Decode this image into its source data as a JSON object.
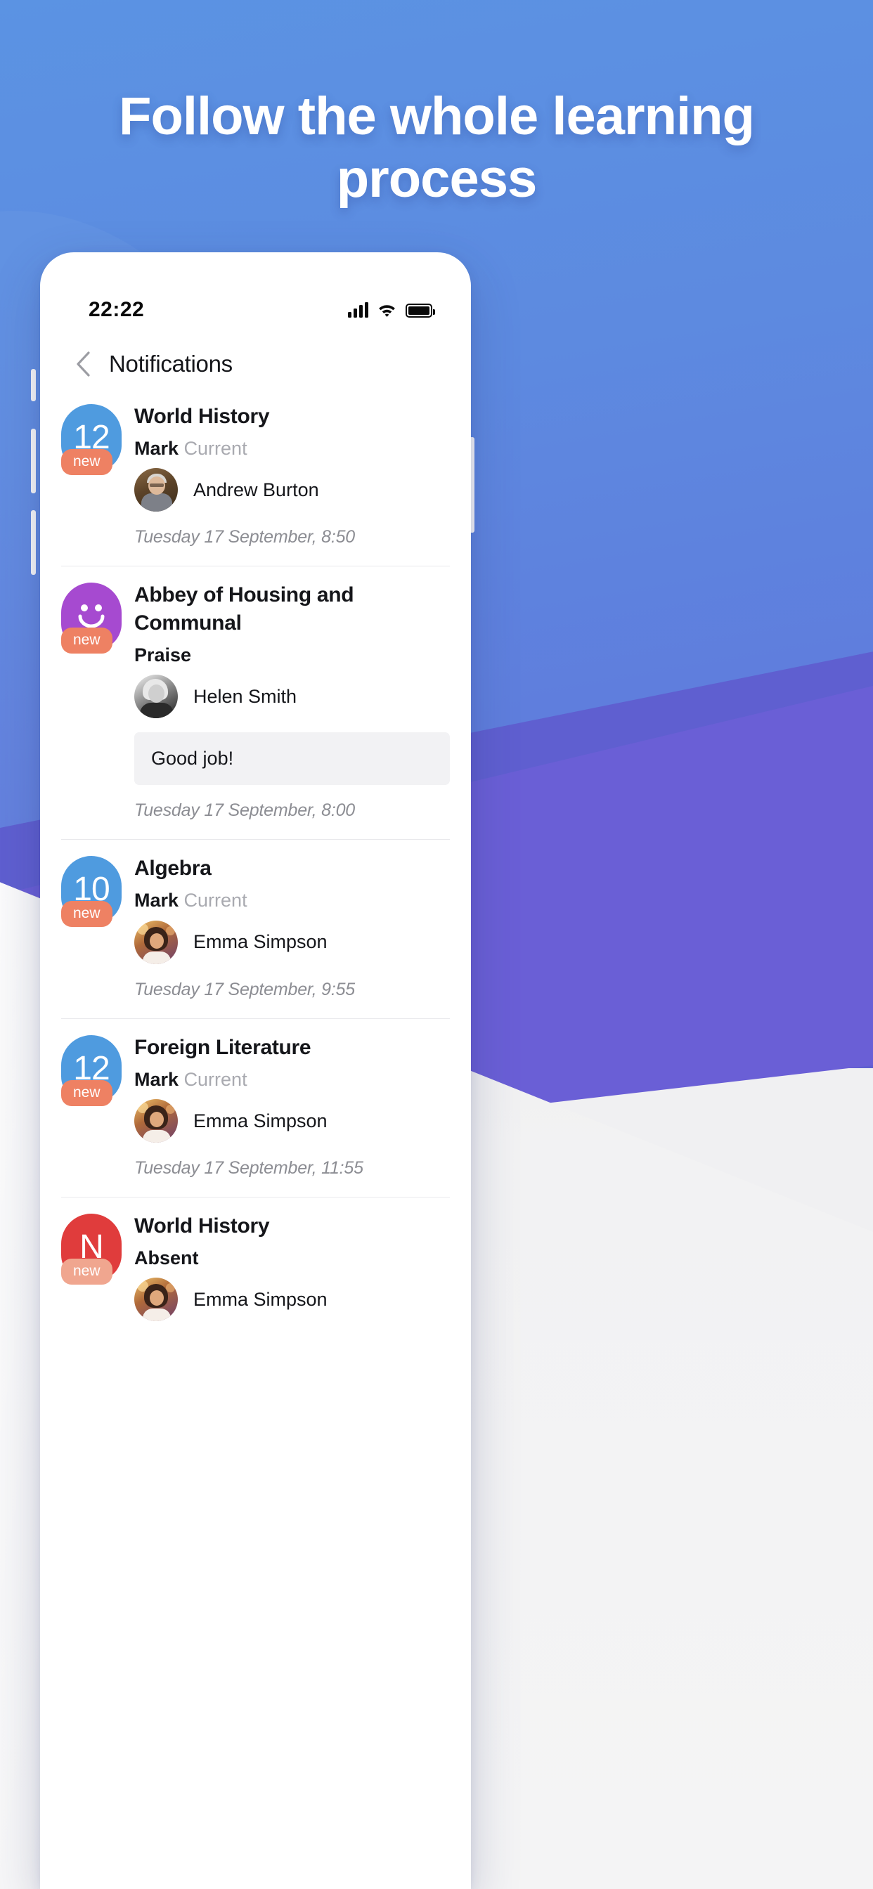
{
  "hero": {
    "headline": "Follow the whole learning process"
  },
  "colors": {
    "bg_blue_top": "#5b93e3",
    "bg_blue_bottom": "#6070da",
    "wave_purple": "#6a5fd6",
    "badge_blue": "#4f9bdf",
    "badge_purple": "#a64ad0",
    "badge_red": "#e03c3c",
    "pill_orange": "#ee8163",
    "pill_orange_light": "#f0a68f",
    "muted_text": "#a9aab0",
    "time_text": "#8c8d93"
  },
  "statusbar": {
    "time": "22:22",
    "signal_icon": "signal-bars-icon",
    "wifi_icon": "wifi-icon",
    "battery_icon": "battery-icon"
  },
  "navbar": {
    "back_icon": "chevron-left-icon",
    "title": "Notifications"
  },
  "notifications": [
    {
      "badge_value": "12",
      "badge_type": "number",
      "badge_color": "#4f9bdf",
      "new_label": "new",
      "new_color": "#ee8163",
      "title": "World History",
      "subtitle_bold": "Mark",
      "subtitle_muted": "Current",
      "person": "Andrew Burton",
      "avatar": "avatar-andrew-burton",
      "message": "",
      "time": "Tuesday 17 September, 8:50"
    },
    {
      "badge_value": "",
      "badge_type": "smiley",
      "badge_color": "#a64ad0",
      "new_label": "new",
      "new_color": "#ee8163",
      "title": "Abbey of Housing and Communal",
      "subtitle_bold": "Praise",
      "subtitle_muted": "",
      "person": "Helen Smith",
      "avatar": "avatar-helen-smith",
      "message": "Good job!",
      "time": "Tuesday 17 September, 8:00"
    },
    {
      "badge_value": "10",
      "badge_type": "number",
      "badge_color": "#4f9bdf",
      "new_label": "new",
      "new_color": "#ee8163",
      "title": "Algebra",
      "subtitle_bold": "Mark",
      "subtitle_muted": "Current",
      "person": "Emma Simpson",
      "avatar": "avatar-emma-simpson",
      "message": "",
      "time": "Tuesday 17 September, 9:55"
    },
    {
      "badge_value": "12",
      "badge_type": "number",
      "badge_color": "#4f9bdf",
      "new_label": "new",
      "new_color": "#ee8163",
      "title": "Foreign Literature",
      "subtitle_bold": "Mark",
      "subtitle_muted": "Current",
      "person": "Emma Simpson",
      "avatar": "avatar-emma-simpson",
      "message": "",
      "time": "Tuesday 17 September, 11:55"
    },
    {
      "badge_value": "N",
      "badge_type": "letter",
      "badge_color": "#e03c3c",
      "new_label": "new",
      "new_color": "#f0a68f",
      "title": "World History",
      "subtitle_bold": "Absent",
      "subtitle_muted": "",
      "person": "Emma Simpson",
      "avatar": "avatar-emma-simpson",
      "message": "",
      "time": ""
    }
  ]
}
